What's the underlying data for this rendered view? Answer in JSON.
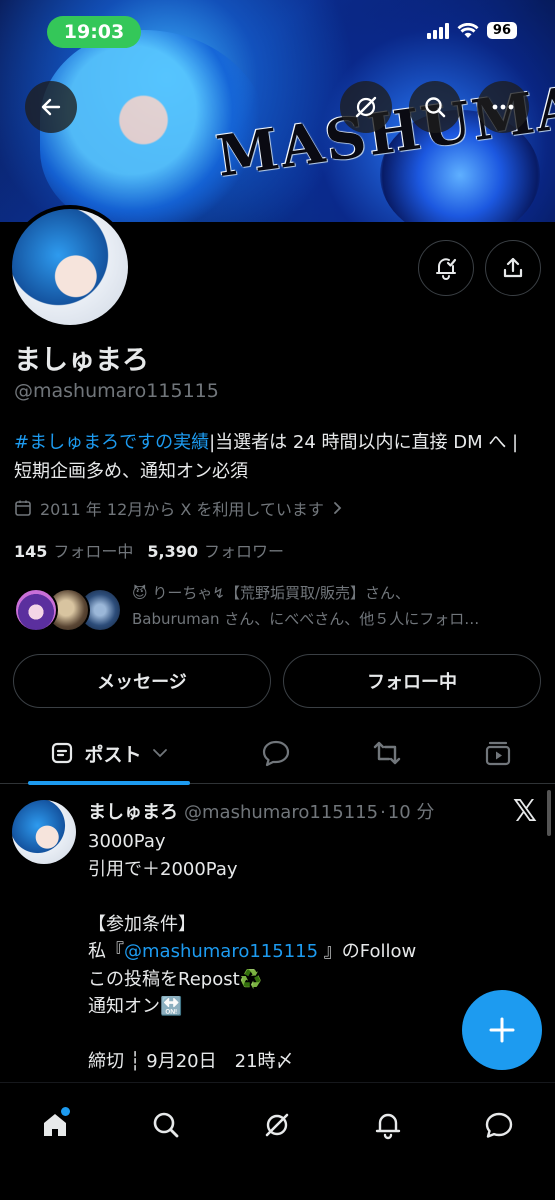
{
  "status_bar": {
    "time": "19:03",
    "battery": "96"
  },
  "banner": {
    "text": "MASHUMARO"
  },
  "profile": {
    "display_name": "ましゅまろ",
    "handle": "@mashumaro115115",
    "bio_hashtag": "#ましゅまろですの実績",
    "bio_rest": "|当選者は 24 時間以内に直接 DM へ |短期企画多め、通知オン必須",
    "joined": "2011 年 12月から X を利用しています",
    "following_count": "145",
    "following_label": "フォロー中",
    "followers_count": "5,390",
    "followers_label": "フォロワー",
    "known_followers_line1": "😈 りーちゃ↯【荒野垢買取/販売】さん、",
    "known_followers_line2": "Baburuman さん、にべべさん、他５人にフォロ…"
  },
  "actions": {
    "message": "メッセージ",
    "following": "フォロー中"
  },
  "tabs": {
    "posts": "ポスト"
  },
  "post": {
    "name": "ましゅまろ",
    "handle": "@mashumaro115115",
    "time": "10 分",
    "line1": "3000Pay",
    "line2": "引用で＋2000Pay",
    "line3": "【参加条件】",
    "line4_pre": "私『",
    "line4_mention": "@mashumaro115115",
    "line4_post": " 』のFollow",
    "line5": "この投稿をRepost♻️",
    "line6": "通知オン🔛",
    "line7": "締切 ┆ 9月20日　21時〆"
  },
  "colors": {
    "accent": "#1d9bf0",
    "background": "#000000",
    "muted": "#71767b",
    "status_green": "#34c759"
  }
}
